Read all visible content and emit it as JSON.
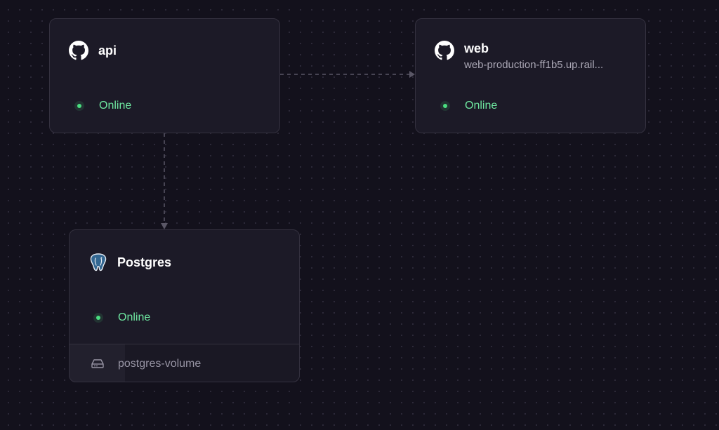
{
  "canvas": {
    "services": [
      {
        "name": "api",
        "icon": "github-icon",
        "status": "Online"
      },
      {
        "name": "web",
        "icon": "github-icon",
        "url": "web-production-ff1b5.up.rail...",
        "status": "Online"
      },
      {
        "name": "Postgres",
        "icon": "postgres-elephant-icon",
        "status": "Online",
        "volume": {
          "name": "postgres-volume",
          "icon": "hard-drive-icon"
        }
      }
    ],
    "connections": [
      {
        "from": "api",
        "to": "web",
        "style": "dashed"
      },
      {
        "from": "api",
        "to": "Postgres",
        "style": "dashed"
      }
    ]
  },
  "colors": {
    "background": "#13111c",
    "card": "#1c1a27",
    "border": "#34313f",
    "status_online": "#4ade80",
    "status_text": "#6ee7a0"
  }
}
